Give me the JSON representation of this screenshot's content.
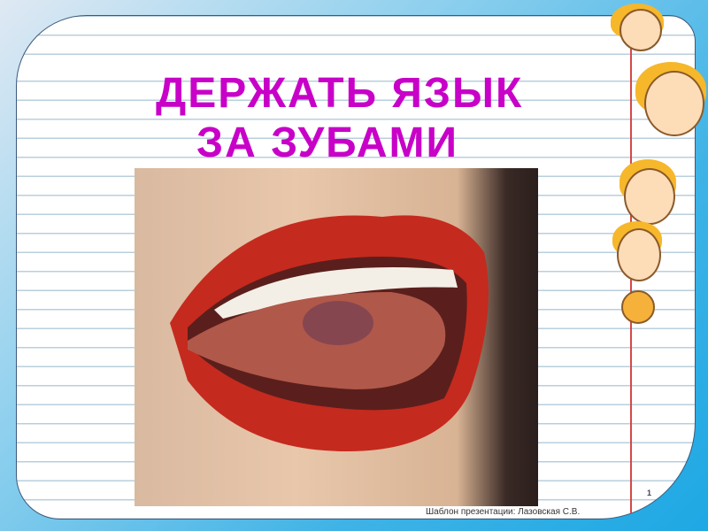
{
  "slide": {
    "title_line1": "ДЕРЖАТЬ ЯЗЫК",
    "title_line2": "ЗА ЗУБАМИ",
    "page_number": "1",
    "footer": "Шаблон презентации: Лазовская С.В."
  },
  "colors": {
    "title": "#c800c8",
    "frame": "#1ea8e4",
    "margin_line": "#d54848"
  },
  "images": {
    "photo": "open-mouth-tongue-photo",
    "decoration": "cartoon-kids"
  }
}
